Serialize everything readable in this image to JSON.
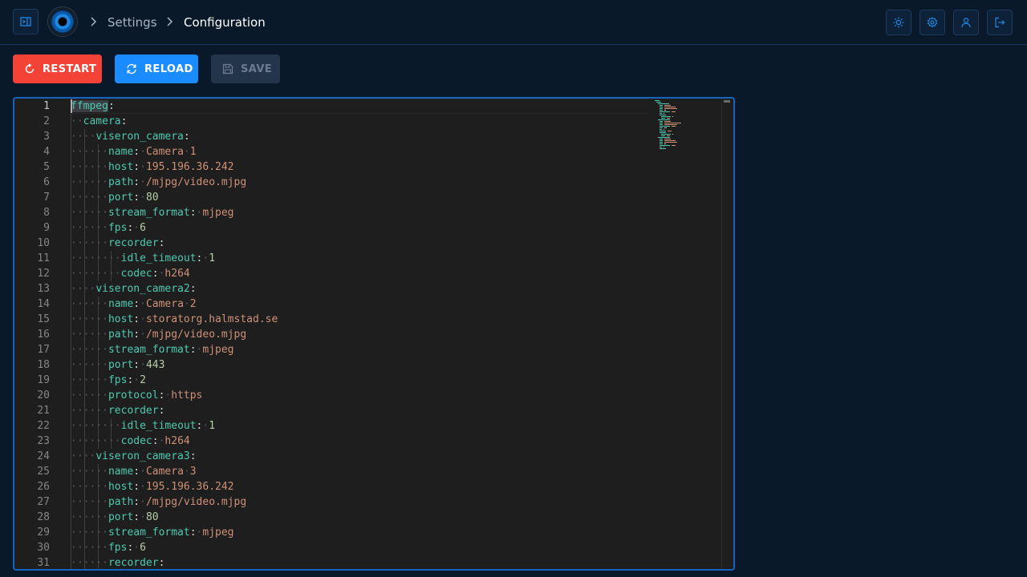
{
  "header": {
    "breadcrumbs": [
      "Settings",
      "Configuration"
    ],
    "icons": [
      "sidebar-toggle-icon",
      "theme-icon",
      "settings-icon",
      "user-icon",
      "logout-icon"
    ]
  },
  "toolbar": {
    "restart_label": "RESTART",
    "reload_label": "RELOAD",
    "save_label": "SAVE"
  },
  "colors": {
    "restart": "#f44336",
    "reload": "#1a8cff",
    "save_disabled": "#23354a",
    "editor_border": "#1565c0",
    "yaml_key": "#4ec9b0",
    "yaml_string": "#ce9178",
    "yaml_number": "#b5cea8"
  },
  "editor": {
    "active_line": 1,
    "lines": [
      {
        "n": "1",
        "indent": 0,
        "key": "ffmpeg"
      },
      {
        "n": "2",
        "indent": 1,
        "key": "camera"
      },
      {
        "n": "3",
        "indent": 2,
        "key": "viseron_camera"
      },
      {
        "n": "4",
        "indent": 3,
        "key": "name",
        "value": "Camera 1",
        "vtype": "str"
      },
      {
        "n": "5",
        "indent": 3,
        "key": "host",
        "value": "195.196.36.242",
        "vtype": "str"
      },
      {
        "n": "6",
        "indent": 3,
        "key": "path",
        "value": "/mjpg/video.mjpg",
        "vtype": "str"
      },
      {
        "n": "7",
        "indent": 3,
        "key": "port",
        "value": "80",
        "vtype": "num"
      },
      {
        "n": "8",
        "indent": 3,
        "key": "stream_format",
        "value": "mjpeg",
        "vtype": "str"
      },
      {
        "n": "9",
        "indent": 3,
        "key": "fps",
        "value": "6",
        "vtype": "num"
      },
      {
        "n": "10",
        "indent": 3,
        "key": "recorder"
      },
      {
        "n": "11",
        "indent": 4,
        "key": "idle_timeout",
        "value": "1",
        "vtype": "num"
      },
      {
        "n": "12",
        "indent": 4,
        "key": "codec",
        "value": "h264",
        "vtype": "str"
      },
      {
        "n": "13",
        "indent": 2,
        "key": "viseron_camera2"
      },
      {
        "n": "14",
        "indent": 3,
        "key": "name",
        "value": "Camera 2",
        "vtype": "str"
      },
      {
        "n": "15",
        "indent": 3,
        "key": "host",
        "value": "storatorg.halmstad.se",
        "vtype": "str"
      },
      {
        "n": "16",
        "indent": 3,
        "key": "path",
        "value": "/mjpg/video.mjpg",
        "vtype": "str"
      },
      {
        "n": "17",
        "indent": 3,
        "key": "stream_format",
        "value": "mjpeg",
        "vtype": "str"
      },
      {
        "n": "18",
        "indent": 3,
        "key": "port",
        "value": "443",
        "vtype": "num"
      },
      {
        "n": "19",
        "indent": 3,
        "key": "fps",
        "value": "2",
        "vtype": "num"
      },
      {
        "n": "20",
        "indent": 3,
        "key": "protocol",
        "value": "https",
        "vtype": "str"
      },
      {
        "n": "21",
        "indent": 3,
        "key": "recorder"
      },
      {
        "n": "22",
        "indent": 4,
        "key": "idle_timeout",
        "value": "1",
        "vtype": "num"
      },
      {
        "n": "23",
        "indent": 4,
        "key": "codec",
        "value": "h264",
        "vtype": "str"
      },
      {
        "n": "24",
        "indent": 2,
        "key": "viseron_camera3"
      },
      {
        "n": "25",
        "indent": 3,
        "key": "name",
        "value": "Camera 3",
        "vtype": "str"
      },
      {
        "n": "26",
        "indent": 3,
        "key": "host",
        "value": "195.196.36.242",
        "vtype": "str"
      },
      {
        "n": "27",
        "indent": 3,
        "key": "path",
        "value": "/mjpg/video.mjpg",
        "vtype": "str"
      },
      {
        "n": "28",
        "indent": 3,
        "key": "port",
        "value": "80",
        "vtype": "num"
      },
      {
        "n": "29",
        "indent": 3,
        "key": "stream_format",
        "value": "mjpeg",
        "vtype": "str"
      },
      {
        "n": "30",
        "indent": 3,
        "key": "fps",
        "value": "6",
        "vtype": "num"
      },
      {
        "n": "31",
        "indent": 3,
        "key": "recorder"
      }
    ]
  }
}
